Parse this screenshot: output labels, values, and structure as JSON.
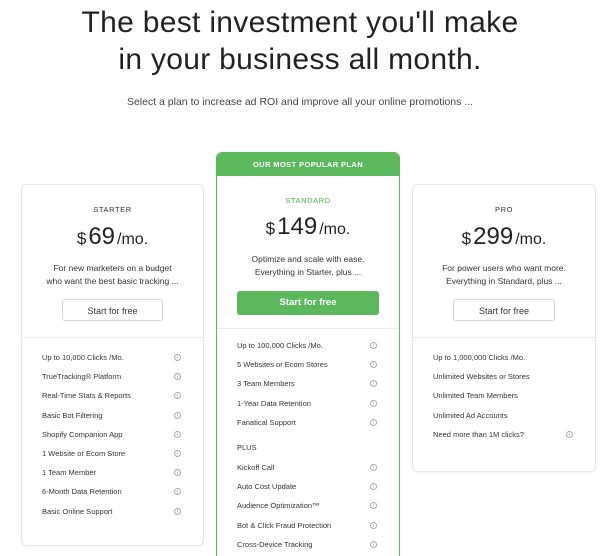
{
  "hero": {
    "title_line1": "The best investment you'll make",
    "title_line2": "in your business all month.",
    "subtitle": "Select a plan to increase ad ROI and improve all your online promotions ..."
  },
  "colors": {
    "accent": "#5cb85c",
    "text": "#1f2124"
  },
  "plans": {
    "starter": {
      "name": "STARTER",
      "currency": "$",
      "price": "69",
      "period": "/mo.",
      "desc_line1": "For new marketers on a budget",
      "desc_line2": "who want the best basic tracking ...",
      "cta": "Start for free",
      "features": [
        "Up to 10,000 Clicks /Mo.",
        "TrueTracking® Platform",
        "Real-Time Stats & Reports",
        "Basic Bot Filtering",
        "Shopify Companion App",
        "1 Website or Ecom Store",
        "1 Team Member",
        "6-Month Data Retention",
        "Basic Online Support"
      ]
    },
    "standard": {
      "banner": "OUR MOST POPULAR PLAN",
      "name": "STANDARD",
      "currency": "$",
      "price": "149",
      "period": "/mo.",
      "desc_line1": "Optimize and scale with ease.",
      "desc_line2": "Everything in Starter, plus ...",
      "cta": "Start for free",
      "features": [
        "Up to 100,000 Clicks /Mo.",
        "5 Websites or Ecom Stores",
        "3 Team Members",
        "1-Year Data Retention",
        "Fanatical Support"
      ],
      "plus_label": "PLUS",
      "plus_features": [
        "Kickoff Call",
        "Auto Cost Update",
        "Audience Optimization™",
        "Bot & Click Fraud Protection",
        "Cross-Device Tracking"
      ]
    },
    "pro": {
      "name": "PRO",
      "currency": "$",
      "price": "299",
      "period": "/mo.",
      "desc_line1": "For power users who want more.",
      "desc_line2": "Everything in Standard, plus ...",
      "cta": "Start for free",
      "features": [
        "Up to 1,000,000 Clicks /Mo.",
        "Unlimited Websites or Stores",
        "Unlimited Team Members",
        "Unlimited Ad Accounts",
        "Need more than 1M clicks?"
      ]
    }
  },
  "icons": {
    "info": "info-circle-icon",
    "info_glyph": "i"
  }
}
